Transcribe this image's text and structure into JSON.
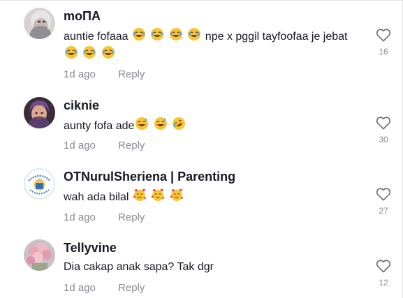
{
  "comments": [
    {
      "username": "moΠA",
      "text_parts": [
        "auntie fofaaa",
        "npe x pggil tayfoofaa je jebat"
      ],
      "emojis_a": [
        "laugh",
        "laugh",
        "laugh",
        "laugh"
      ],
      "emojis_b": [
        "laugh",
        "laugh",
        "laugh"
      ],
      "time": "1d ago",
      "reply": "Reply",
      "likes": "16"
    },
    {
      "username": "ciknie",
      "text": "aunty fofa ade",
      "emojis": [
        "grin-sweat",
        "grin-sweat",
        "rofl"
      ],
      "time": "1d ago",
      "reply": "Reply",
      "likes": "30"
    },
    {
      "username": "OTNurulSheriena | Parenting",
      "text": "wah ada bilal",
      "emojis": [
        "hearts-face",
        "hearts-face",
        "hearts-face"
      ],
      "time": "1d ago",
      "reply": "Reply",
      "likes": "27"
    },
    {
      "username": "Tellyvine",
      "text": "Dia cakap anak sapa? Tak dgr",
      "time": "1d ago",
      "reply": "Reply",
      "likes": "12"
    }
  ],
  "colors": {
    "text": "#161823",
    "muted": "#8a8b91",
    "emoji_yellow": "#f7c531"
  },
  "icons": {
    "like": "heart-outline-icon"
  }
}
